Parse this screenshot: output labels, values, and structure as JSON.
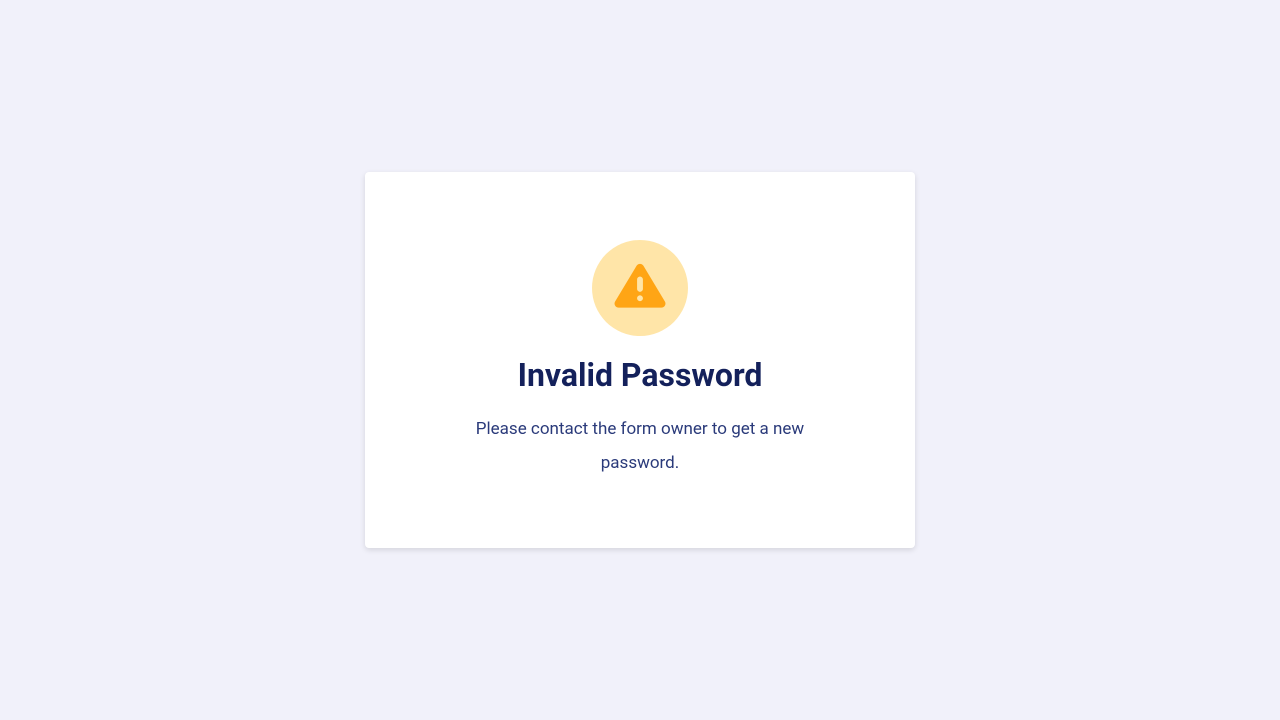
{
  "card": {
    "title": "Invalid Password",
    "message": "Please contact the form owner to get a new password."
  },
  "icon": {
    "name": "warning-triangle"
  },
  "colors": {
    "background": "#f1f1fa",
    "card_bg": "#ffffff",
    "icon_circle": "#ffe5a8",
    "icon_fill": "#ffa515",
    "title_color": "#14215b",
    "message_color": "#2a3a7a"
  }
}
